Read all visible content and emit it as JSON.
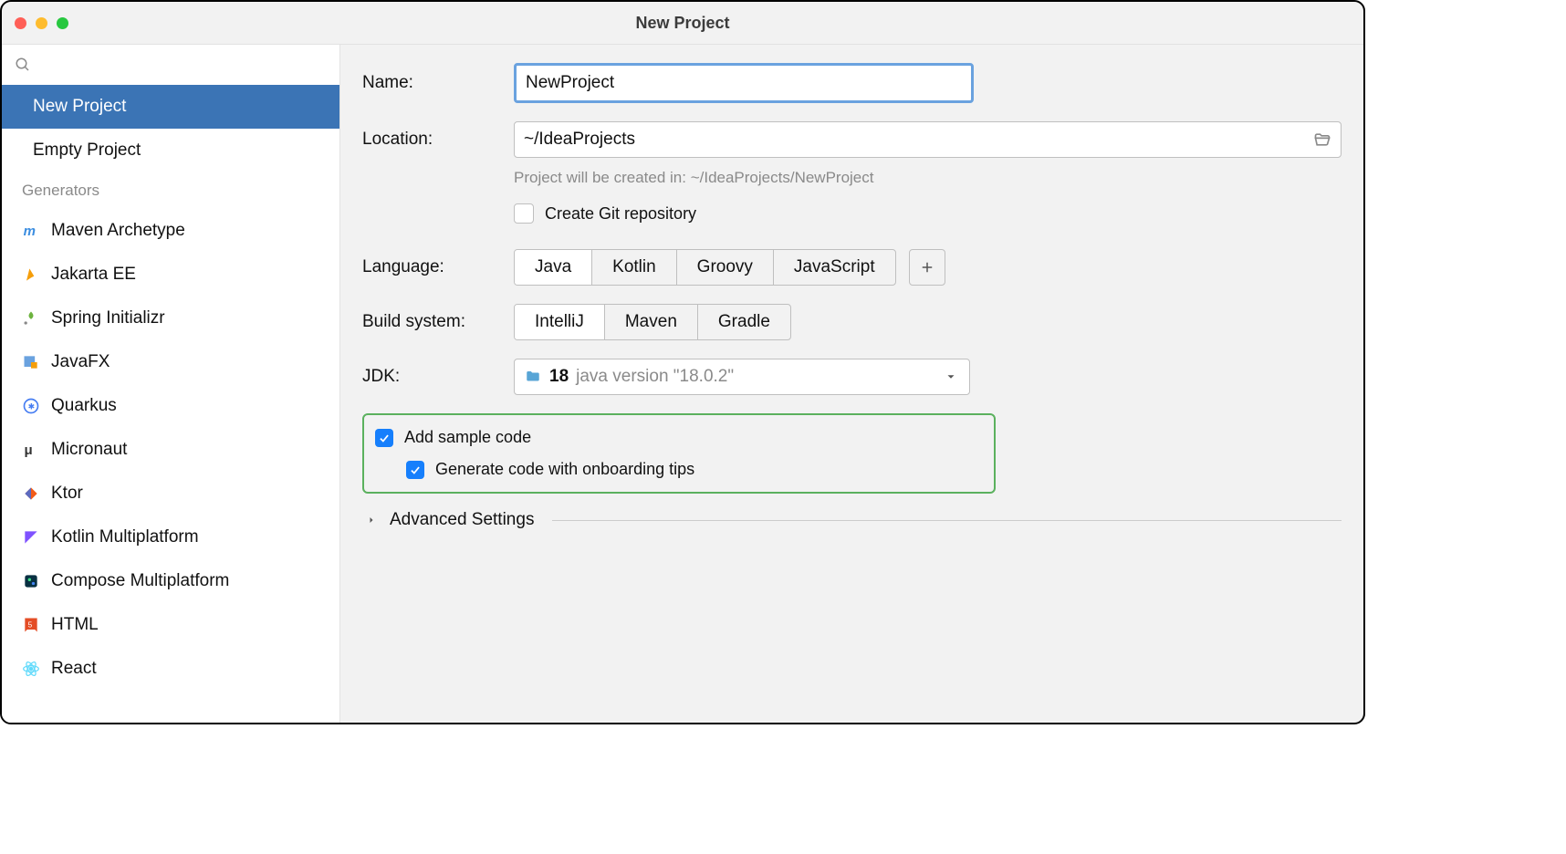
{
  "window": {
    "title": "New Project"
  },
  "traffic": {
    "close": "#ff5f57",
    "min": "#febc2e",
    "max": "#28c840"
  },
  "sidebar": {
    "top": [
      "New Project",
      "Empty Project"
    ],
    "selected": 0,
    "section": "Generators",
    "generators": [
      "Maven Archetype",
      "Jakarta EE",
      "Spring Initializr",
      "JavaFX",
      "Quarkus",
      "Micronaut",
      "Ktor",
      "Kotlin Multiplatform",
      "Compose Multiplatform",
      "HTML",
      "React"
    ]
  },
  "form": {
    "name_label": "Name:",
    "name_value": "NewProject",
    "location_label": "Location:",
    "location_value": "~/IdeaProjects",
    "location_hint": "Project will be created in: ~/IdeaProjects/NewProject",
    "git_label": "Create Git repository",
    "language_label": "Language:",
    "languages": [
      "Java",
      "Kotlin",
      "Groovy",
      "JavaScript"
    ],
    "language_selected": 0,
    "build_label": "Build system:",
    "builds": [
      "IntelliJ",
      "Maven",
      "Gradle"
    ],
    "build_selected": 0,
    "jdk_label": "JDK:",
    "jdk_version": "18",
    "jdk_desc": "java version \"18.0.2\"",
    "sample_label": "Add sample code",
    "onboard_label": "Generate code with onboarding tips",
    "advanced": "Advanced Settings"
  }
}
